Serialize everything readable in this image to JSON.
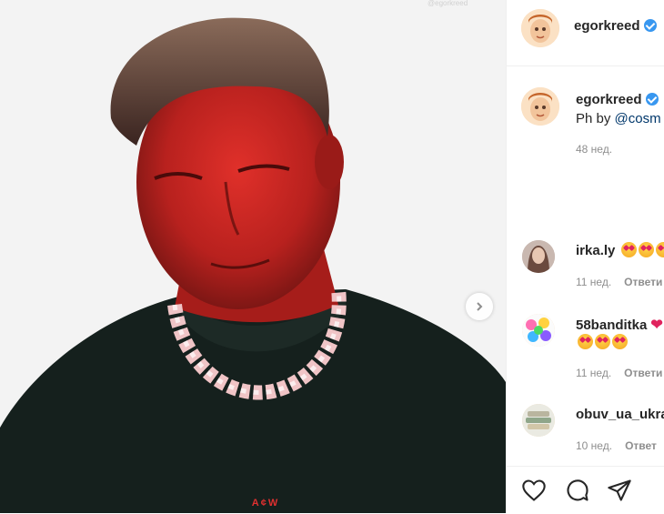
{
  "post": {
    "author": "egorkreed",
    "caption_prefix": "Ph by",
    "caption_mention": "@cosm",
    "age": "48 нед.",
    "photo_watermark": "@egorkreed",
    "shirt_logo": "A¢W"
  },
  "comments": [
    {
      "user": "irka.ly",
      "age": "11 нед.",
      "reply": "Ответи"
    },
    {
      "user": "58banditka",
      "age": "11 нед.",
      "reply": "Ответи"
    },
    {
      "user": "obuv_ua_ukra",
      "age": "10 нед.",
      "reply": "Ответ"
    }
  ],
  "icons": [
    "heart-icon",
    "comment-icon",
    "share-icon",
    "chevron-right-icon",
    "verified-icon"
  ]
}
